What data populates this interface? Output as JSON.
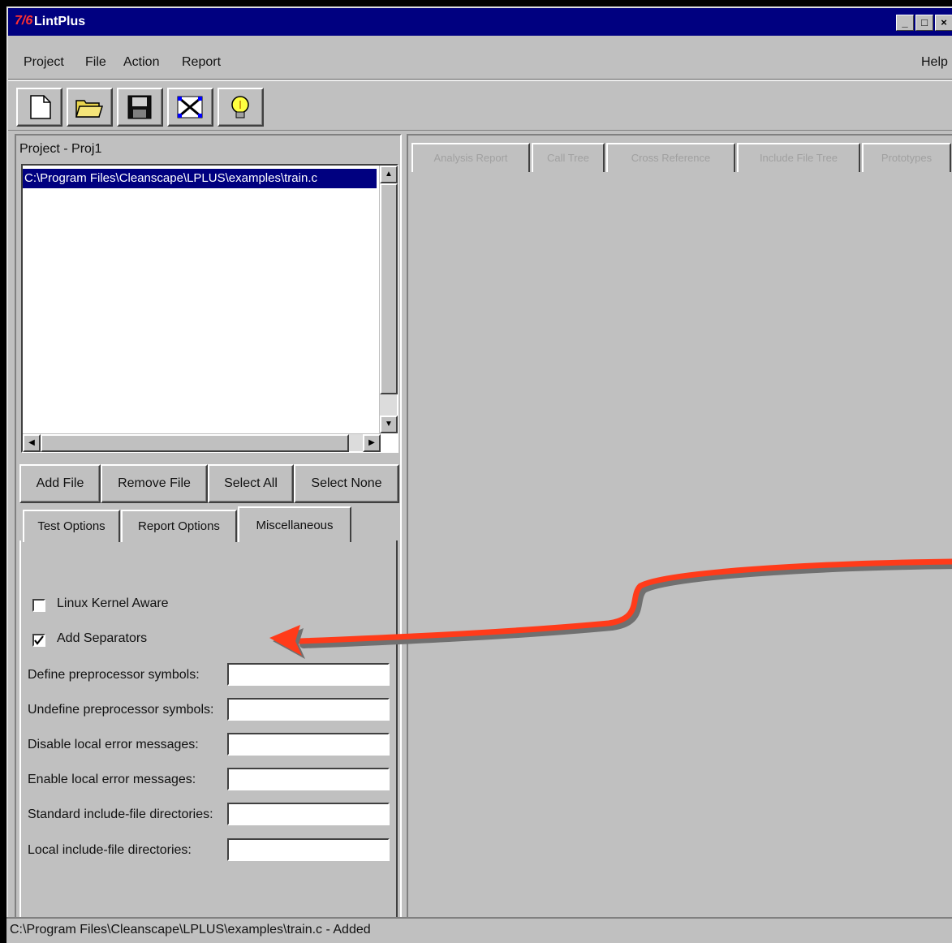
{
  "window": {
    "title": "LintPlus",
    "logo": "7/6",
    "minimize": "_",
    "maximize": "□",
    "close": "×"
  },
  "menu": {
    "items": [
      "Project",
      "File",
      "Action",
      "Report"
    ],
    "help": "Help"
  },
  "toolbar": {
    "icons": [
      "new-file-icon",
      "open-folder-icon",
      "save-icon",
      "fit-view-icon",
      "lightbulb-icon"
    ]
  },
  "project": {
    "label": "Project - Proj1",
    "files": [
      "C:\\Program Files\\Cleanscape\\LPLUS\\examples\\train.c"
    ]
  },
  "file_buttons": {
    "add": "Add File",
    "remove": "Remove File",
    "select_all": "Select All",
    "select_none": "Select None"
  },
  "left_tabs": [
    "Test Options",
    "Report Options",
    "Miscellaneous"
  ],
  "misc": {
    "linux_kernel_aware": {
      "label": "Linux Kernel Aware",
      "checked": false
    },
    "add_separators": {
      "label": "Add Separators",
      "checked": true
    },
    "fields": [
      {
        "label": "Define preprocessor symbols:",
        "value": ""
      },
      {
        "label": "Undefine preprocessor symbols:",
        "value": ""
      },
      {
        "label": "Disable local error messages:",
        "value": ""
      },
      {
        "label": "Enable local error messages:",
        "value": ""
      },
      {
        "label": "Standard include-file directories:",
        "value": ""
      },
      {
        "label": "Local include-file directories:",
        "value": ""
      }
    ]
  },
  "right_tabs": [
    "Analysis Report",
    "Call Tree",
    "Cross Reference",
    "Include File Tree",
    "Prototypes"
  ],
  "status": {
    "text": "C:\\Program Files\\Cleanscape\\LPLUS\\examples\\train.c - Added"
  },
  "colors": {
    "titlebar": "#000080",
    "selection": "#000080",
    "face": "#c0c0c0",
    "annotation_arrow": "#ff3b1a"
  }
}
